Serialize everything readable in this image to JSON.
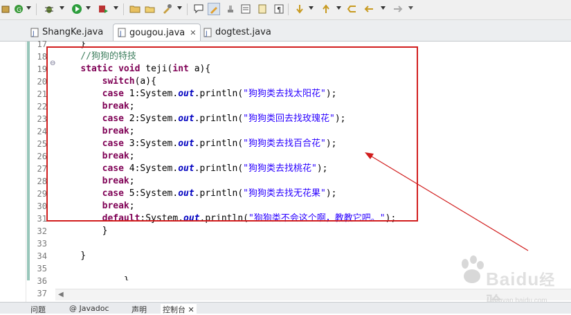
{
  "toolbar": {
    "icons": [
      "package-icon",
      "run-green-icon",
      "debug-icon",
      "run-icon",
      "external-tool-icon",
      "new-folder-icon",
      "open-icon",
      "tools-icon",
      "annotation-icon",
      "edit-icon",
      "stamp-icon",
      "outline-icon",
      "paragraph-icon",
      "next-annotation-icon",
      "prev-annotation-icon",
      "last-edit-icon",
      "back-icon",
      "forward-icon"
    ]
  },
  "tabs": [
    {
      "label": "ShangKe.java",
      "active": false
    },
    {
      "label": "gougou.java",
      "active": true,
      "close": "✕"
    },
    {
      "label": "dogtest.java",
      "active": false
    }
  ],
  "editor": {
    "line_numbers": [
      "17",
      "18",
      "19",
      "20",
      "21",
      "22",
      "23",
      "24",
      "25",
      "26",
      "27",
      "28",
      "29",
      "30",
      "31",
      "32",
      "33",
      "34",
      "35",
      "36",
      "37"
    ],
    "fold_marker": "⊖",
    "lines": [
      {
        "tokens": [
          {
            "t": "    }",
            "c": ""
          }
        ]
      },
      {
        "tokens": [
          {
            "t": "    //狗狗的特技",
            "c": "cm"
          }
        ]
      },
      {
        "tokens": [
          {
            "t": "    ",
            "c": ""
          },
          {
            "t": "static",
            "c": "kw"
          },
          {
            "t": " ",
            "c": ""
          },
          {
            "t": "void",
            "c": "kw"
          },
          {
            "t": " teji(",
            "c": ""
          },
          {
            "t": "int",
            "c": "kw"
          },
          {
            "t": " a){",
            "c": ""
          }
        ]
      },
      {
        "tokens": [
          {
            "t": "        ",
            "c": ""
          },
          {
            "t": "switch",
            "c": "kw"
          },
          {
            "t": "(a){",
            "c": ""
          }
        ]
      },
      {
        "tokens": [
          {
            "t": "        ",
            "c": ""
          },
          {
            "t": "case",
            "c": "kw"
          },
          {
            "t": " 1:System.",
            "c": ""
          },
          {
            "t": "out",
            "c": "fd"
          },
          {
            "t": ".println(",
            "c": ""
          },
          {
            "t": "\"狗狗类去找太阳花\"",
            "c": "st"
          },
          {
            "t": ");",
            "c": ""
          }
        ]
      },
      {
        "tokens": [
          {
            "t": "        ",
            "c": ""
          },
          {
            "t": "break",
            "c": "kw"
          },
          {
            "t": ";",
            "c": ""
          }
        ]
      },
      {
        "tokens": [
          {
            "t": "        ",
            "c": ""
          },
          {
            "t": "case",
            "c": "kw"
          },
          {
            "t": " 2:System.",
            "c": ""
          },
          {
            "t": "out",
            "c": "fd"
          },
          {
            "t": ".println(",
            "c": ""
          },
          {
            "t": "\"狗狗类回去找玫瑰花\"",
            "c": "st"
          },
          {
            "t": ");",
            "c": ""
          }
        ]
      },
      {
        "tokens": [
          {
            "t": "        ",
            "c": ""
          },
          {
            "t": "break",
            "c": "kw"
          },
          {
            "t": ";",
            "c": ""
          }
        ]
      },
      {
        "tokens": [
          {
            "t": "        ",
            "c": ""
          },
          {
            "t": "case",
            "c": "kw"
          },
          {
            "t": " 3:System.",
            "c": ""
          },
          {
            "t": "out",
            "c": "fd"
          },
          {
            "t": ".println(",
            "c": ""
          },
          {
            "t": "\"狗狗类去找百合花\"",
            "c": "st"
          },
          {
            "t": ");",
            "c": ""
          }
        ]
      },
      {
        "tokens": [
          {
            "t": "        ",
            "c": ""
          },
          {
            "t": "break",
            "c": "kw"
          },
          {
            "t": ";",
            "c": ""
          }
        ]
      },
      {
        "tokens": [
          {
            "t": "        ",
            "c": ""
          },
          {
            "t": "case",
            "c": "kw"
          },
          {
            "t": " 4:System.",
            "c": ""
          },
          {
            "t": "out",
            "c": "fd"
          },
          {
            "t": ".println(",
            "c": ""
          },
          {
            "t": "\"狗狗类去找桃花\"",
            "c": "st"
          },
          {
            "t": ");",
            "c": ""
          }
        ]
      },
      {
        "tokens": [
          {
            "t": "        ",
            "c": ""
          },
          {
            "t": "break",
            "c": "kw"
          },
          {
            "t": ";",
            "c": ""
          }
        ]
      },
      {
        "tokens": [
          {
            "t": "        ",
            "c": ""
          },
          {
            "t": "case",
            "c": "kw"
          },
          {
            "t": " 5:System.",
            "c": ""
          },
          {
            "t": "out",
            "c": "fd"
          },
          {
            "t": ".println(",
            "c": ""
          },
          {
            "t": "\"狗狗类去找无花果\"",
            "c": "st"
          },
          {
            "t": ");",
            "c": ""
          }
        ]
      },
      {
        "tokens": [
          {
            "t": "        ",
            "c": ""
          },
          {
            "t": "break",
            "c": "kw"
          },
          {
            "t": ";",
            "c": ""
          }
        ]
      },
      {
        "tokens": [
          {
            "t": "        ",
            "c": ""
          },
          {
            "t": "default",
            "c": "kw"
          },
          {
            "t": ":System.",
            "c": ""
          },
          {
            "t": "out",
            "c": "fd"
          },
          {
            "t": ".println(",
            "c": ""
          },
          {
            "t": "\"狗狗类不会这个啊，教教它吧。\"",
            "c": "st"
          },
          {
            "t": ");",
            "c": ""
          }
        ]
      },
      {
        "tokens": [
          {
            "t": "        }",
            "c": ""
          }
        ]
      },
      {
        "tokens": [
          {
            "t": "",
            "c": ""
          }
        ]
      },
      {
        "tokens": [
          {
            "t": "    }",
            "c": ""
          }
        ]
      },
      {
        "tokens": [
          {
            "t": "",
            "c": ""
          }
        ]
      },
      {
        "tokens": [
          {
            "t": "            }",
            "c": ""
          }
        ]
      },
      {
        "tokens": [
          {
            "t": "",
            "c": ""
          }
        ]
      }
    ]
  },
  "annotation": {
    "box_color": "#d11d1d",
    "arrow_color": "#d11d1d"
  },
  "bottom_panel": {
    "tabs": [
      "问题",
      "@ Javadoc",
      "声明",
      "控制台 ✕"
    ]
  },
  "watermark": {
    "brand": "Baidu",
    "suffix": "经验",
    "url": "jingyan.baidu.com"
  },
  "colors": {
    "keyword": "#7f0055",
    "comment": "#3f7f5f",
    "string": "#2a00ff",
    "field": "#0000c0",
    "change_ruler": "#98c6ba"
  }
}
